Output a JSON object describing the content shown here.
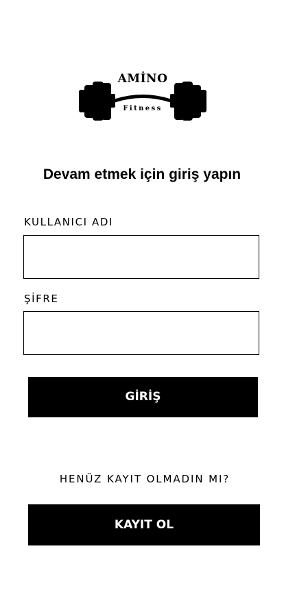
{
  "brand": {
    "name": "AMİNO",
    "tagline": "Fitness",
    "logo_icon": "barbell-icon"
  },
  "login": {
    "heading": "Devam etmek için giriş yapın",
    "username_label": "KULLANICI ADI",
    "username_value": "",
    "password_label": "ŞİFRE",
    "password_value": "",
    "submit_label": "GİRİŞ"
  },
  "register": {
    "prompt": "HENÜZ KAYIT OLMADIN MI?",
    "button_label": "KAYIT OL"
  },
  "colors": {
    "primary": "#000000",
    "background": "#ffffff",
    "button_text": "#ffffff"
  }
}
